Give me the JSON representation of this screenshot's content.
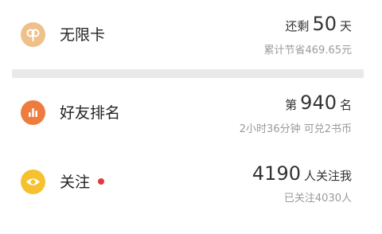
{
  "rows": [
    {
      "label": "无限卡",
      "prefix": "还剩",
      "number": "50",
      "suffix": "天",
      "subtext": "累计节省469.65元",
      "icon": "infinity-card-icon",
      "icon_color": "#EFC08A"
    },
    {
      "label": "好友排名",
      "prefix": "第",
      "number": "940",
      "suffix": "名",
      "subtext": "2小时36分钟 可兑2书币",
      "icon": "bar-chart-icon",
      "icon_color": "#EF7C3F"
    },
    {
      "label": "关注",
      "number": "4190",
      "suffix": "人关注我",
      "subtext": "已关注4030人",
      "icon": "eye-icon",
      "icon_color": "#F5C12E",
      "has_red_dot": true,
      "red_dot_color": "#E8383D"
    }
  ]
}
